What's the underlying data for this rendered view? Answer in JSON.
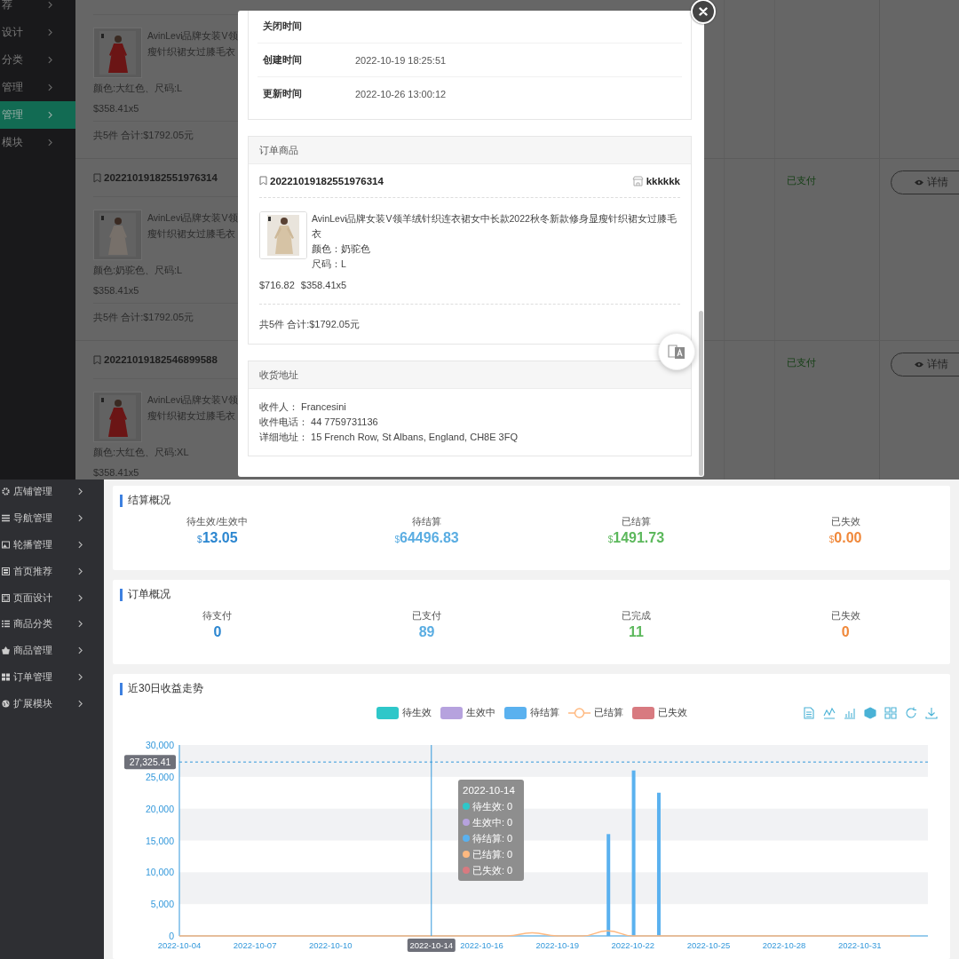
{
  "backdrop": {
    "sidebar": {
      "items": [
        {
          "label": "荐",
          "selected": false
        },
        {
          "label": "设计",
          "selected": false
        },
        {
          "label": "分类",
          "selected": false
        },
        {
          "label": "管理",
          "selected": false
        },
        {
          "label": "管理",
          "selected": true
        },
        {
          "label": "模块",
          "selected": false
        }
      ]
    },
    "orders": [
      {
        "product": {
          "title_lines": [
            "AvinLevi品牌女装V领",
            "瘦针织裙女过膝毛衣"
          ],
          "spec": "颜色:大红色、尺码:L",
          "price": "$358.41x5"
        },
        "total": "共5件 合计:$1792.05元"
      },
      {
        "number": "20221019182551976314",
        "status": "已支付",
        "action": "详情",
        "product": {
          "title_lines": [
            "AvinLevi品牌女装V领",
            "瘦针织裙女过膝毛衣"
          ],
          "spec": "颜色:奶驼色、尺码:L",
          "price": "$358.41x5"
        },
        "total": "共5件 合计:$1792.05元"
      },
      {
        "number": "20221019182546899588",
        "status": "已支付",
        "action": "详情",
        "product": {
          "title_lines": [
            "AvinLevi品牌女装V领",
            "瘦针织裙女过膝毛衣"
          ],
          "spec": "颜色:大红色、尺码:XL",
          "price": "$358.41x5"
        }
      }
    ]
  },
  "dialog": {
    "info_rows": [
      {
        "label": "关闭时间"
      },
      {
        "label": "创建时间",
        "value": "2022-10-19 18:25:51"
      },
      {
        "label": "更新时间",
        "value": "2022-10-26 13:00:12"
      }
    ],
    "goods": {
      "title": "订单商品",
      "order_number": "20221019182551976314",
      "shop": "kkkkkk",
      "product": {
        "title": "AvinLevi品牌女装V领羊绒针织连衣裙女中长款2022秋冬新款修身显瘦针织裙女过膝毛衣",
        "variant": "颜色：奶驼色",
        "size": "尺码：L"
      },
      "amount": "$716.82",
      "unit_price": "$358.41x5",
      "total": "共5件 合计:$1792.05元"
    },
    "address": {
      "title": "收货地址",
      "lines": [
        "收件人： Francesini",
        "收件电话： 44 7759731136",
        "详细地址： 15 French Row, St Albans, England, CH8E 3FQ"
      ]
    }
  },
  "dashboard": {
    "sidebar": [
      {
        "label": "店铺管理"
      },
      {
        "label": "导航管理"
      },
      {
        "label": "轮播管理"
      },
      {
        "label": "首页推荐"
      },
      {
        "label": "页面设计"
      },
      {
        "label": "商品分类"
      },
      {
        "label": "商品管理"
      },
      {
        "label": "订单管理"
      },
      {
        "label": "扩展模块"
      }
    ],
    "settlement": {
      "title": "结算概况",
      "stats": [
        {
          "label": "待生效/生效中",
          "currency": "$",
          "value": "13.05",
          "color": "#2b86d0"
        },
        {
          "label": "待结算",
          "currency": "$",
          "value": "64496.83",
          "color": "#5aade2"
        },
        {
          "label": "已结算",
          "currency": "$",
          "value": "1491.73",
          "color": "#5cb85c"
        },
        {
          "label": "已失效",
          "currency": "$",
          "value": "0.00",
          "color": "#f0883a"
        }
      ]
    },
    "orders": {
      "title": "订单概况",
      "stats": [
        {
          "label": "待支付",
          "value": "0",
          "color": "#2b86d0"
        },
        {
          "label": "已支付",
          "value": "89",
          "color": "#5aade2"
        },
        {
          "label": "已完成",
          "value": "11",
          "color": "#5cb85c"
        },
        {
          "label": "已失效",
          "value": "0",
          "color": "#f0883a"
        }
      ]
    },
    "trend": {
      "title": "近30日收益走势",
      "chart_data": {
        "type": "bar",
        "stacked": false,
        "categories": [
          "2022-10-04",
          null,
          null,
          "2022-10-07",
          null,
          null,
          "2022-10-10",
          null,
          null,
          null,
          "2022-10-14",
          null,
          "2022-10-16",
          null,
          null,
          "2022-10-19",
          null,
          null,
          "2022-10-22",
          null,
          null,
          "2022-10-25",
          null,
          null,
          "2022-10-28",
          null,
          null,
          "2022-10-31",
          null,
          null
        ],
        "series": [
          {
            "name": "待生效",
            "color": "#2ec7c9",
            "values": [
              0,
              0,
              0,
              0,
              0,
              0,
              0,
              0,
              0,
              0,
              0,
              0,
              0,
              0,
              0,
              0,
              0,
              0,
              0,
              0,
              0,
              0,
              0,
              0,
              0,
              0,
              0,
              0,
              0,
              0
            ]
          },
          {
            "name": "生效中",
            "color": "#b6a2de",
            "values": [
              0,
              0,
              0,
              0,
              0,
              0,
              0,
              0,
              0,
              0,
              0,
              0,
              0,
              0,
              0,
              0,
              0,
              0,
              0,
              0,
              0,
              0,
              0,
              0,
              0,
              0,
              0,
              0,
              0,
              0
            ]
          },
          {
            "name": "待结算",
            "color": "#5ab1ef",
            "values": [
              0,
              0,
              0,
              0,
              0,
              0,
              0,
              0,
              0,
              0,
              0,
              0,
              0,
              0,
              0,
              0,
              0,
              16000,
              26000,
              22500,
              0,
              0,
              0,
              0,
              0,
              0,
              0,
              0,
              0,
              0
            ]
          },
          {
            "name": "已结算",
            "type": "line",
            "color": "#ffb980",
            "values": [
              0,
              0,
              0,
              0,
              0,
              0,
              0,
              0,
              0,
              0,
              0,
              0,
              0,
              0,
              500,
              0,
              0,
              800,
              0,
              0,
              0,
              0,
              0,
              0,
              0,
              0,
              0,
              0,
              0,
              0
            ]
          },
          {
            "name": "已失效",
            "color": "#d87a80",
            "values": [
              0,
              0,
              0,
              0,
              0,
              0,
              0,
              0,
              0,
              0,
              0,
              0,
              0,
              0,
              0,
              0,
              0,
              0,
              0,
              0,
              0,
              0,
              0,
              0,
              0,
              0,
              0,
              0,
              0,
              0
            ]
          }
        ],
        "ylim": [
          0,
          30000
        ],
        "yticks": [
          {
            "value": 0,
            "label": "0"
          },
          {
            "value": 5000,
            "label": "5,000"
          },
          {
            "value": 10000,
            "label": "10,000"
          },
          {
            "value": 15000,
            "label": "15,000"
          },
          {
            "value": 20000,
            "label": "20,000"
          },
          {
            "value": 25000,
            "label": "25,000"
          },
          {
            "value": 30000,
            "label": "30,000"
          }
        ],
        "ref_lines": [
          {
            "axis": "y",
            "value": 27325.41,
            "label": "27,325.41"
          },
          {
            "axis": "x",
            "value": "2022-10-14"
          }
        ]
      },
      "tooltip": {
        "title": "2022-10-14",
        "rows": [
          {
            "text": "待生效: 0",
            "color": "#2ec7c9"
          },
          {
            "text": "生效中: 0",
            "color": "#b6a2de"
          },
          {
            "text": "待结算: 0",
            "color": "#5ab1ef"
          },
          {
            "text": "已结算: 0",
            "color": "#ffb980"
          },
          {
            "text": "已失效: 0",
            "color": "#d87a80"
          }
        ]
      }
    }
  }
}
